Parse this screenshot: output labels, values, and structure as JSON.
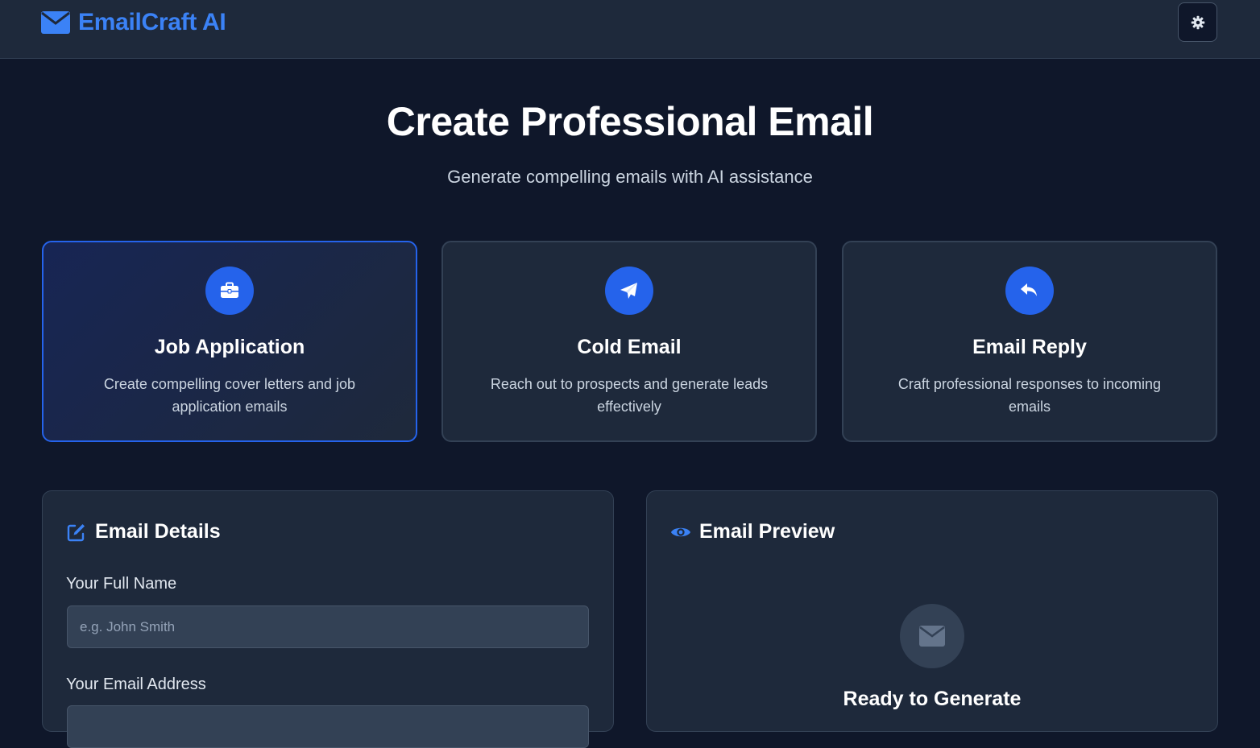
{
  "app": {
    "name": "EmailCraft AI",
    "logo_icon": "envelope-icon",
    "settings_icon": "gear-icon"
  },
  "hero": {
    "title": "Create Professional Email",
    "subtitle": "Generate compelling emails with AI assistance"
  },
  "email_types": [
    {
      "title": "Job Application",
      "description": "Create compelling cover letters and job application emails",
      "icon": "briefcase-icon",
      "selected": true
    },
    {
      "title": "Cold Email",
      "description": "Reach out to prospects and generate leads effectively",
      "icon": "paper-plane-icon",
      "selected": false
    },
    {
      "title": "Email Reply",
      "description": "Craft professional responses to incoming emails",
      "icon": "reply-icon",
      "selected": false
    }
  ],
  "details": {
    "title": "Email Details",
    "icon": "edit-icon",
    "fields": [
      {
        "label": "Your Full Name",
        "placeholder": "e.g. John Smith",
        "value": ""
      },
      {
        "label": "Your Email Address"
      }
    ]
  },
  "preview": {
    "title": "Email Preview",
    "icon": "eye-icon",
    "empty_icon": "envelope-icon",
    "empty_title": "Ready to Generate"
  },
  "colors": {
    "accent": "#2563eb",
    "brand": "#3b82f6",
    "background": "#0f172a",
    "surface": "#1e293b",
    "border": "#334155"
  }
}
